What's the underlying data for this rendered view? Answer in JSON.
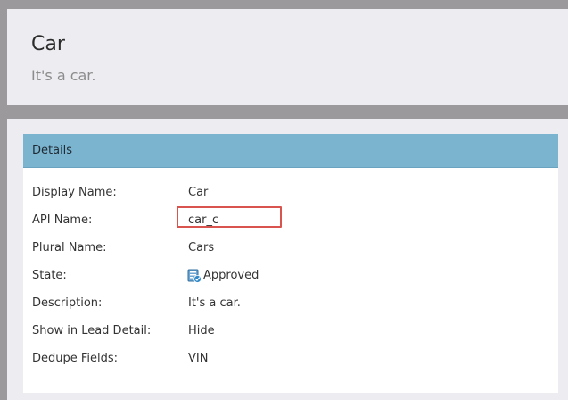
{
  "header": {
    "title": "Car",
    "subtitle": "It's a car."
  },
  "details": {
    "section_title": "Details",
    "rows": [
      {
        "label": "Display Name:",
        "value": "Car"
      },
      {
        "label": "API Name:",
        "value": "car_c"
      },
      {
        "label": "Plural Name:",
        "value": "Cars"
      },
      {
        "label": "State:",
        "value": "Approved",
        "icon": "approved-status-icon"
      },
      {
        "label": "Description:",
        "value": "It's a car."
      },
      {
        "label": "Show in Lead Detail:",
        "value": "Hide"
      },
      {
        "label": "Dedupe Fields:",
        "value": "VIN"
      }
    ]
  },
  "colors": {
    "panel_background": "#edecf1",
    "page_background": "#9b999c",
    "section_header": "#7ab4cf",
    "highlight_border": "#d9534f",
    "approved_icon": "#2f88c7"
  }
}
